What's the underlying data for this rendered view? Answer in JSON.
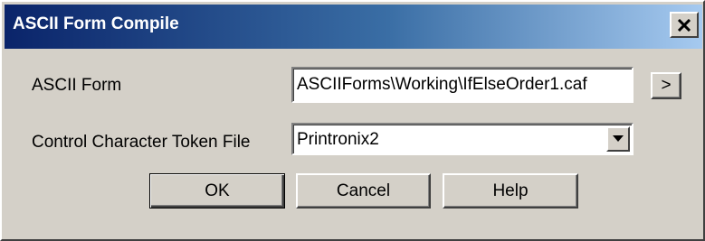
{
  "window": {
    "title": "ASCII Form Compile",
    "close_glyph": "×"
  },
  "form": {
    "ascii_form_label": "ASCII Form",
    "ascii_form_value": "ASCIIForms\\Working\\IfElseOrder1.caf",
    "browse_label": ">",
    "token_file_label": "Control Character Token File",
    "token_file_value": "Printronix2"
  },
  "buttons": {
    "ok": "OK",
    "cancel": "Cancel",
    "help": "Help"
  },
  "colors": {
    "title_gradient_start": "#0a246a",
    "title_gradient_end": "#a6caf0",
    "face": "#d4d0c8"
  }
}
